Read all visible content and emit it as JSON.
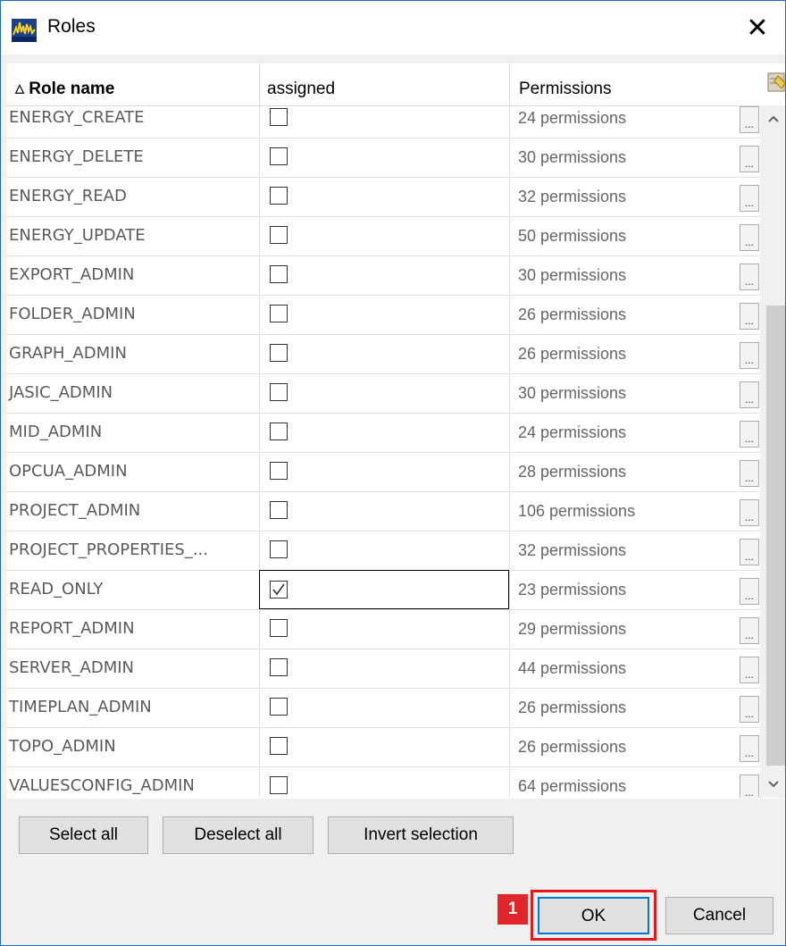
{
  "window": {
    "title": "Roles",
    "app_icon": "app-logo-icon",
    "close_icon": "close-icon"
  },
  "table": {
    "columns": {
      "role_name": "Role name",
      "assigned": "assigned",
      "permissions": "Permissions"
    },
    "sort_indicator": "ascending",
    "rows": [
      {
        "role": "ENERGY_CREATE",
        "assigned": false,
        "permissions": "24 permissions",
        "more": "..."
      },
      {
        "role": "ENERGY_DELETE",
        "assigned": false,
        "permissions": "30 permissions",
        "more": "..."
      },
      {
        "role": "ENERGY_READ",
        "assigned": false,
        "permissions": "32 permissions",
        "more": "..."
      },
      {
        "role": "ENERGY_UPDATE",
        "assigned": false,
        "permissions": "50 permissions",
        "more": "..."
      },
      {
        "role": "EXPORT_ADMIN",
        "assigned": false,
        "permissions": "30 permissions",
        "more": "..."
      },
      {
        "role": "FOLDER_ADMIN",
        "assigned": false,
        "permissions": "26 permissions",
        "more": "..."
      },
      {
        "role": "GRAPH_ADMIN",
        "assigned": false,
        "permissions": "26 permissions",
        "more": "..."
      },
      {
        "role": "JASIC_ADMIN",
        "assigned": false,
        "permissions": "30 permissions",
        "more": "..."
      },
      {
        "role": "MID_ADMIN",
        "assigned": false,
        "permissions": "24 permissions",
        "more": "..."
      },
      {
        "role": "OPCUA_ADMIN",
        "assigned": false,
        "permissions": "28 permissions",
        "more": "..."
      },
      {
        "role": "PROJECT_ADMIN",
        "assigned": false,
        "permissions": "106 permissions",
        "more": "..."
      },
      {
        "role": "PROJECT_PROPERTIES_...",
        "assigned": false,
        "permissions": "32 permissions",
        "more": "..."
      },
      {
        "role": "READ_ONLY",
        "assigned": true,
        "permissions": "23 permissions",
        "more": "..."
      },
      {
        "role": "REPORT_ADMIN",
        "assigned": false,
        "permissions": "29 permissions",
        "more": "..."
      },
      {
        "role": "SERVER_ADMIN",
        "assigned": false,
        "permissions": "44 permissions",
        "more": "..."
      },
      {
        "role": "TIMEPLAN_ADMIN",
        "assigned": false,
        "permissions": "26 permissions",
        "more": "..."
      },
      {
        "role": "TOPO_ADMIN",
        "assigned": false,
        "permissions": "26 permissions",
        "more": "..."
      },
      {
        "role": "VALUESCONFIG_ADMIN",
        "assigned": false,
        "permissions": "64 permissions",
        "more": "..."
      }
    ]
  },
  "buttons": {
    "select_all": "Select all",
    "deselect_all": "Deselect all",
    "invert_selection": "Invert selection",
    "ok": "OK",
    "cancel": "Cancel"
  },
  "annotation": {
    "step_number": "1",
    "highlight_color": "#e8161d"
  }
}
